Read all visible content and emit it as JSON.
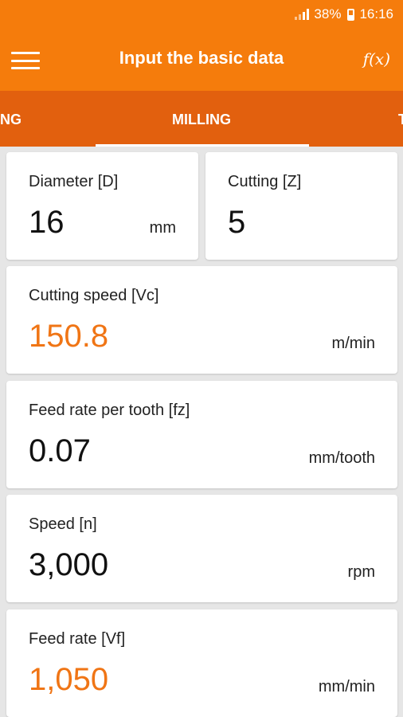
{
  "status_bar": {
    "battery": "38%",
    "time": "16:16"
  },
  "app_bar": {
    "title": "Input the basic data",
    "formula_label": "f(x)"
  },
  "tabs": {
    "left_partial": "NG",
    "active": "MILLING",
    "right_partial": "T"
  },
  "fields": {
    "diameter": {
      "label": "Diameter [D]",
      "value": "16",
      "unit": "mm"
    },
    "cutting": {
      "label": "Cutting [Z]",
      "value": "5"
    },
    "cutting_speed": {
      "label": "Cutting speed [Vc]",
      "value": "150.8",
      "unit": "m/min"
    },
    "feed_per_tooth": {
      "label": "Feed rate per tooth [fz]",
      "value": "0.07",
      "unit": "mm/tooth"
    },
    "speed": {
      "label": "Speed [n]",
      "value": "3,000",
      "unit": "rpm"
    },
    "feed_rate": {
      "label": "Feed rate [Vf]",
      "value": "1,050",
      "unit": "mm/min"
    }
  },
  "colors": {
    "primary": "#f57c0c",
    "tab_bar": "#e2600e",
    "accent_value": "#f07515"
  }
}
